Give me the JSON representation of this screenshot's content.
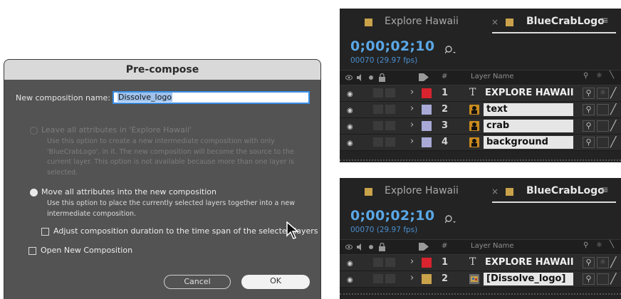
{
  "dialog": {
    "title": "Pre-compose",
    "name_label": "New composition name:",
    "name_value": "Dissolve_logo",
    "option1_label": "Leave all attributes in 'Explore Hawaii'",
    "option1_desc": [
      "Use this option to create a new intermediate composition with only",
      "'BlueCrabLogo', in it. The new composition will become the source to the",
      "current layer. This option is not available because more than one layer is",
      "selected."
    ],
    "option2_label": "Move all attributes into the new composition",
    "option2_desc": [
      "Use this option to place the currently selected layers together into a new",
      "intermediate composition."
    ],
    "adjust_label": "Adjust composition duration to the time span of the selected layers",
    "open_label": "Open New Composition",
    "cancel_label": "Cancel",
    "ok_label": "OK"
  },
  "panel_top": {
    "tab1": "Explore Hawaii",
    "tab2": "BlueCrabLogo",
    "close_glyph": "×",
    "menu_glyph": "≡",
    "timecode": "0;00;02;10",
    "fps": "00070 (29.97 fps)",
    "hash": "#",
    "layer_name_header": "Layer Name",
    "layers": [
      {
        "num": "1",
        "name": "EXPLORE HAWAII",
        "color": "#d9232e",
        "type": "text"
      },
      {
        "num": "2",
        "name": "text",
        "color": "#a9a9d8",
        "type": "footage"
      },
      {
        "num": "3",
        "name": "crab",
        "color": "#a9a9d8",
        "type": "footage"
      },
      {
        "num": "4",
        "name": "background",
        "color": "#a9a9d8",
        "type": "footage"
      }
    ]
  },
  "panel_bottom": {
    "tab1": "Explore Hawaii",
    "tab2": "BlueCrabLogo",
    "close_glyph": "×",
    "menu_glyph": "≡",
    "timecode": "0;00;02;10",
    "fps": "00070 (29.97 fps)",
    "hash": "#",
    "layer_name_header": "Layer Name",
    "layers": [
      {
        "num": "1",
        "name": "EXPLORE HAWAII",
        "color": "#d9232e",
        "type": "text"
      },
      {
        "num": "2",
        "name": "[Dissolve_logo]",
        "color": "#c9a24a",
        "type": "comp"
      }
    ]
  },
  "colors": {
    "accent_blue": "#5aa7e6",
    "tab_swatch": "#c9a24a",
    "dialog_bg": "#535353"
  }
}
